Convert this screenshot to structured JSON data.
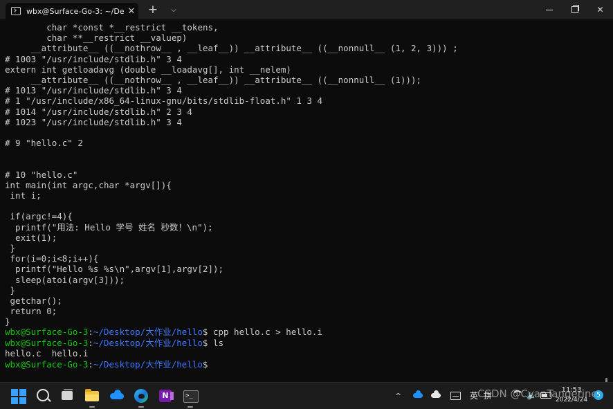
{
  "window": {
    "tab_title": "wbx@Surface-Go-3: ~/De",
    "tab_close": "✕",
    "new_tab": "+",
    "dropdown": "⌵"
  },
  "terminal": {
    "lines": [
      "        char *const *__restrict __tokens,",
      "        char **__restrict __valuep)",
      "     __attribute__ ((__nothrow__ , __leaf__)) __attribute__ ((__nonnull__ (1, 2, 3))) ;",
      "# 1003 \"/usr/include/stdlib.h\" 3 4",
      "extern int getloadavg (double __loadavg[], int __nelem)",
      "     __attribute__ ((__nothrow__ , __leaf__)) __attribute__ ((__nonnull__ (1)));",
      "# 1013 \"/usr/include/stdlib.h\" 3 4",
      "# 1 \"/usr/include/x86_64-linux-gnu/bits/stdlib-float.h\" 1 3 4",
      "# 1014 \"/usr/include/stdlib.h\" 2 3 4",
      "# 1023 \"/usr/include/stdlib.h\" 3 4",
      "",
      "# 9 \"hello.c\" 2",
      "",
      "",
      "# 10 \"hello.c\"",
      "int main(int argc,char *argv[]){",
      " int i;",
      "",
      " if(argc!=4){",
      "  printf(\"用法: Hello 学号 姓名 秒数！\\n\");",
      "  exit(1);",
      " }",
      " for(i=0;i<8;i++){",
      "  printf(\"Hello %s %s\\n\",argv[1],argv[2]);",
      "  sleep(atoi(argv[3]));",
      " }",
      " getchar();",
      " return 0;",
      "}"
    ],
    "prompt_user": "wbx@Surface-Go-3",
    "prompt_path": "~/Desktop/大作业/hello",
    "commands": [
      "cpp hello.c > hello.i",
      "ls",
      ""
    ],
    "ls_output": "hello.c  hello.i"
  },
  "taskbar": {
    "apps": [
      "start",
      "search",
      "task-view",
      "file-explorer",
      "onedrive",
      "edge",
      "onenote",
      "terminal"
    ],
    "tray_chevron": "^",
    "lang": "英",
    "ime": "拼",
    "speaker": "🔈",
    "watermark": "CSDN @CyanTangerine",
    "time": "11:53",
    "date": "2022/4/24",
    "notifications": "5"
  },
  "colors": {
    "background": "#0c0c0c",
    "text": "#cccccc",
    "prompt_green": "#16c60c",
    "prompt_blue": "#3b78ff"
  }
}
